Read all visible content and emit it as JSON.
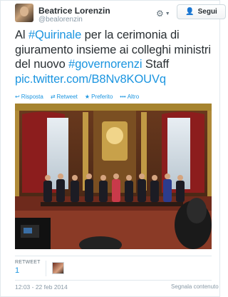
{
  "author": {
    "name": "Beatrice Lorenzin",
    "handle": "@bealorenzin"
  },
  "controls": {
    "settings_icon": "gear-icon",
    "follow_label": "Segui",
    "follow_icon": "add-user-icon"
  },
  "tweet": {
    "t1": "Al ",
    "h1": "#Quirinale",
    "t2": " per la cerimonia di giuramento insieme ai colleghi ministri del nuovo ",
    "h2": "#governorenzi",
    "t3": " Staff",
    "link": "pic.twitter.com/B8Nv8KOUVq"
  },
  "actions": [
    {
      "icon": "reply-icon",
      "label": "Risposta"
    },
    {
      "icon": "retweet-icon",
      "label": "Retweet"
    },
    {
      "icon": "favorite-star-icon",
      "label": "Preferito"
    },
    {
      "icon": "more-dots-icon",
      "label": "Altro"
    }
  ],
  "stats": {
    "retweet_label": "RETWEET",
    "retweet_count": "1"
  },
  "footer": {
    "timestamp": "12:03 - 22 feb 2014",
    "report_label": "Segnala contenuto"
  },
  "colors": {
    "link": "#1b95e0",
    "text": "#292f33",
    "muted": "#8899a6"
  }
}
